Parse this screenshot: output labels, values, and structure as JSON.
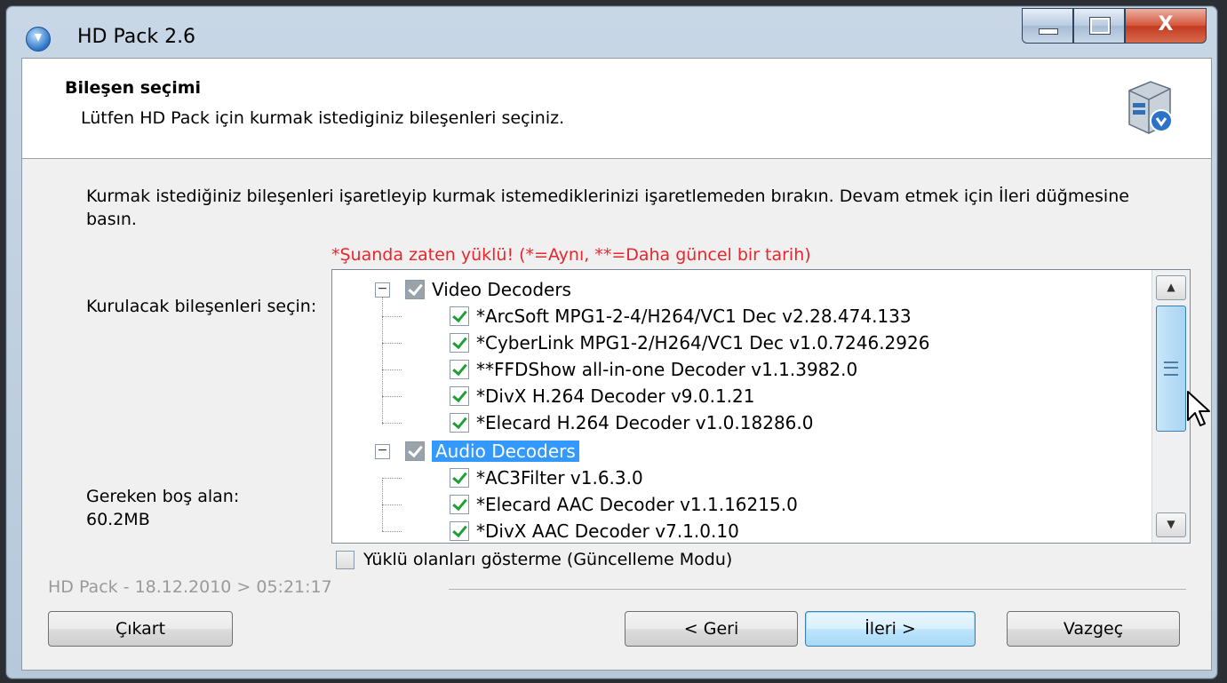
{
  "window": {
    "title": "HD Pack 2.6",
    "close_glyph": "X",
    "controls": [
      "minimize-icon",
      "maximize-icon",
      "close-icon"
    ]
  },
  "header": {
    "title": "Bileşen seçimi",
    "subtitle": "Lütfen HD Pack için kurmak istediginiz bileşenleri seçiniz.",
    "icon": "installer-box-icon"
  },
  "body": {
    "instructions": "Kurmak istediğiniz bileşenleri işaretleyip kurmak istemediklerinizi işaretlemeden bırakın. Devam etmek için İleri düğmesine basın.",
    "installed_note": "*Şuanda zaten yüklü! (*=Aynı, **=Daha güncel bir tarih)",
    "choose_label": "Kurulacak bileşenleri seçin:",
    "space_label": "Gereken boş alan:",
    "space_value": "60.2MB"
  },
  "tree": {
    "groups": [
      {
        "label": "Video Decoders",
        "expanded": true,
        "items": [
          {
            "label": "*ArcSoft MPG1-2-4/H264/VC1 Dec v2.28.474.133",
            "checked": true
          },
          {
            "label": "*CyberLink MPG1-2/H264/VC1 Dec v1.0.7246.2926",
            "checked": true
          },
          {
            "label": "**FFDShow all-in-one Decoder v1.1.3982.0",
            "checked": true
          },
          {
            "label": "*DivX H.264 Decoder v9.0.1.21",
            "checked": true
          },
          {
            "label": "*Elecard H.264 Decoder v1.0.18286.0",
            "checked": true
          }
        ]
      },
      {
        "label": "Audio Decoders",
        "expanded": true,
        "selected": true,
        "items": [
          {
            "label": "*AC3Filter v1.6.3.0",
            "checked": true
          },
          {
            "label": "*Elecard AAC Decoder v1.1.16215.0",
            "checked": true
          },
          {
            "label": "*DivX AAC Decoder v7.1.0.10",
            "checked": true
          }
        ]
      }
    ],
    "expander_glyph": "−"
  },
  "options": {
    "update_mode_label": "Yüklü olanları gösterme (Güncelleme Modu)",
    "update_mode_checked": false
  },
  "footer": {
    "brand": "HD Pack - 18.12.2010 > 05:21:17"
  },
  "buttons": {
    "extract": "Çıkart",
    "back": "< Geri",
    "next": "İleri >",
    "cancel": "Vazgeç"
  },
  "colors": {
    "accent": "#3399ff",
    "warning": "#e8262b",
    "check": "#1f9e35"
  }
}
